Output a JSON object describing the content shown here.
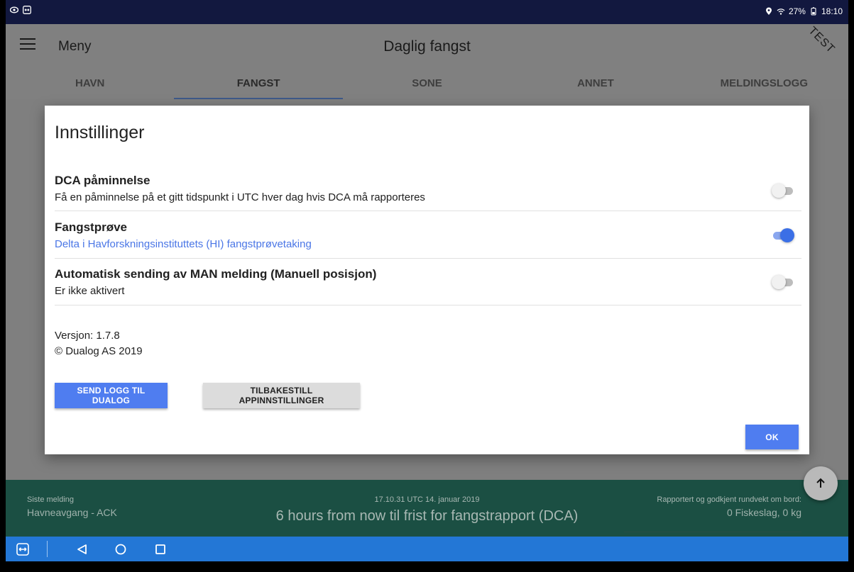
{
  "status": {
    "battery": "27%",
    "time": "18:10"
  },
  "app_bar": {
    "menu_label": "Meny",
    "title": "Daglig fangst",
    "ribbon": "TEST"
  },
  "tabs": [
    {
      "label": "HAVN"
    },
    {
      "label": "FANGST"
    },
    {
      "label": "SONE"
    },
    {
      "label": "ANNET"
    },
    {
      "label": "MELDINGSLOGG"
    }
  ],
  "dialog": {
    "title": "Innstillinger",
    "settings": [
      {
        "title": "DCA påminnelse",
        "description": "Få en påminnelse på et gitt tidspunkt i UTC hver dag hvis DCA må rapporteres",
        "enabled": false
      },
      {
        "title": "Fangstprøve",
        "description": "Delta i Havforskningsinstituttets (HI) fangstprøvetaking",
        "enabled": true
      },
      {
        "title": "Automatisk sending av MAN melding (Manuell posisjon)",
        "description": "Er ikke aktivert",
        "enabled": false
      }
    ],
    "version": "Versjon: 1.7.8",
    "copyright": "© Dualog AS 2019",
    "send_log_label": "SEND LOGG TIL DUALOG",
    "reset_label": "TILBAKESTILL APPINNSTILLINGER",
    "ok_label": "OK"
  },
  "info_bar": {
    "last_message_label": "Siste melding",
    "last_message_value": "Havneavgang - ACK",
    "timestamp": "17.10.31 UTC 14. januar 2019",
    "deadline": "6 hours from now til frist for fangstrapport (DCA)",
    "reported_label": "Rapportert og godkjent rundvekt om bord:",
    "reported_value": "0 Fiskeslag, 0 kg"
  },
  "colors": {
    "accent": "#4f7df0",
    "status_bar": "#12183f",
    "info_bar": "#1b4f43",
    "nav_bar": "#2377d6"
  }
}
